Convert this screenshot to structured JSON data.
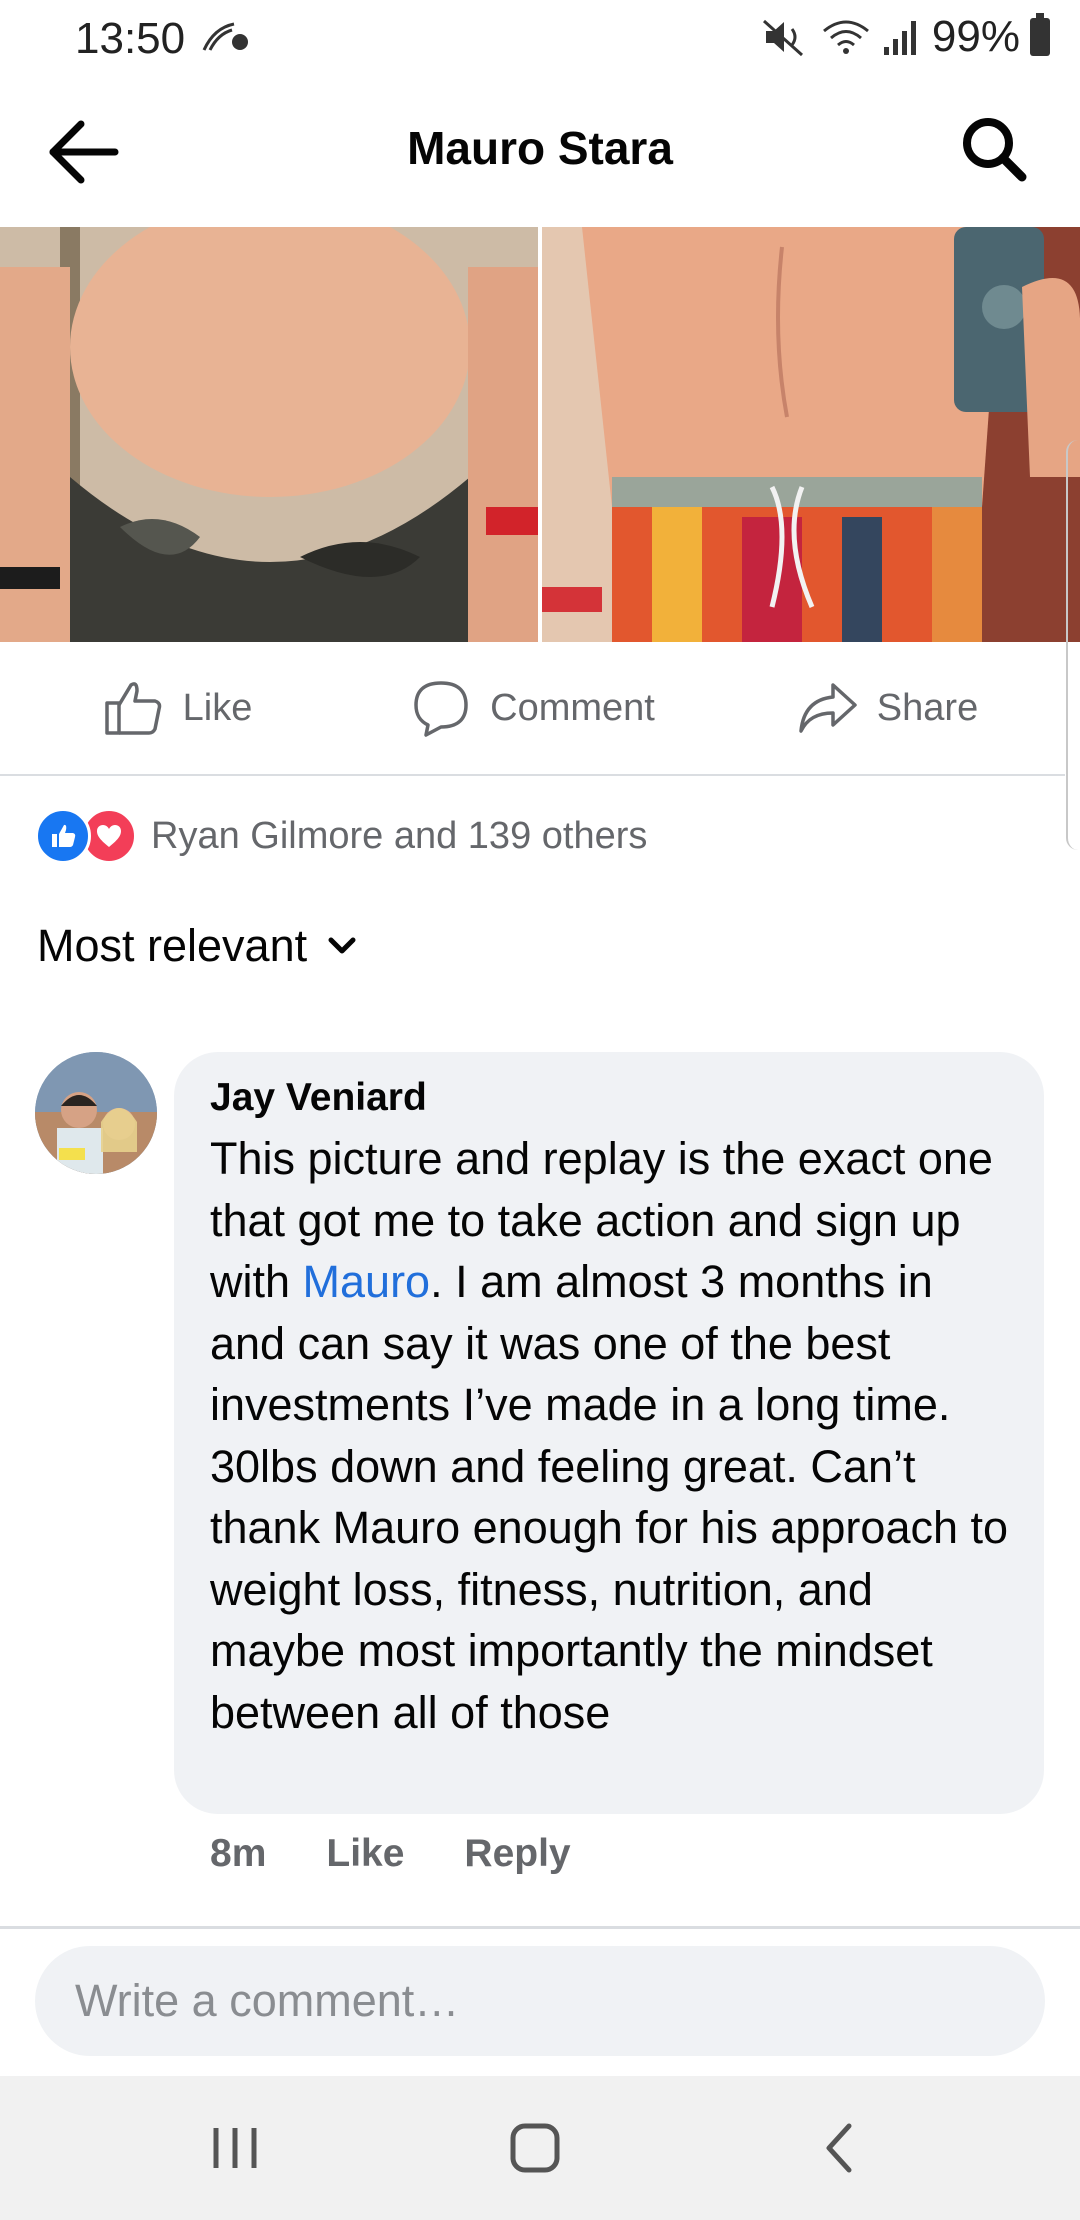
{
  "status_bar": {
    "time": "13:50",
    "battery": "99%"
  },
  "header": {
    "title": "Mauro Stara"
  },
  "post": {
    "photo_alt": "",
    "actions": {
      "like": "Like",
      "comment": "Comment",
      "share": "Share"
    }
  },
  "reactions": {
    "summary": "Ryan Gilmore and 139 others"
  },
  "filter": {
    "label": "Most relevant"
  },
  "comment": {
    "author": "Jay Veniard",
    "text_before": "This picture and replay is the exact one that got me to take action and sign up with ",
    "mention": "Mauro",
    "text_after": ". I am almost 3 months in and can say it was one of the best investments I’ve made in a long time. 30lbs down and feeling great. Can’t thank Mauro enough for his approach to weight loss, fitness, nutrition, and maybe most importantly the mindset between all of those",
    "time": "8m",
    "like": "Like",
    "reply": "Reply"
  },
  "composer": {
    "placeholder": "Write a comment…"
  },
  "colors": {
    "accent": "#1877f2",
    "love": "#f33e58",
    "link": "#216fdb",
    "muted": "#65676b"
  },
  "icons": [
    "back-arrow-icon",
    "search-icon",
    "thumbs-up-icon",
    "comment-icon",
    "share-icon",
    "like-reaction-icon",
    "love-reaction-icon",
    "chevron-down-icon",
    "recents-icon",
    "home-icon",
    "back-icon"
  ]
}
